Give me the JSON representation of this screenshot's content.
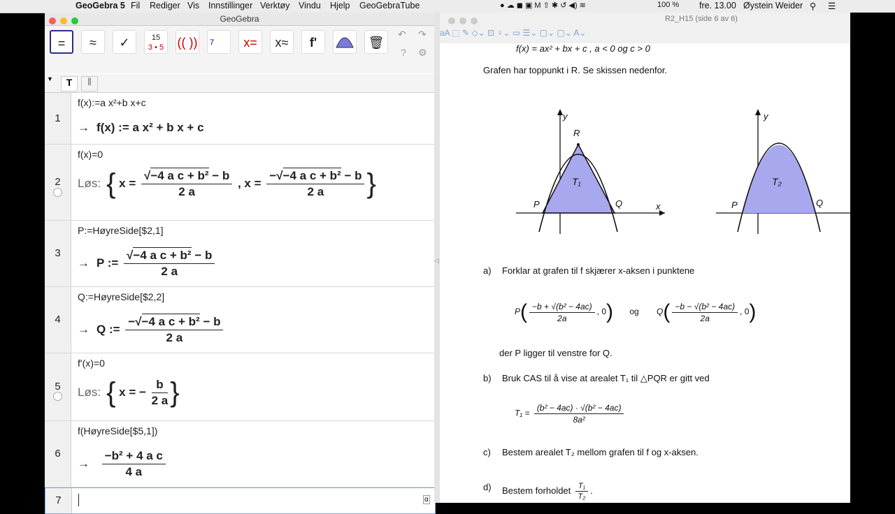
{
  "menubar": {
    "app_name": "GeoGebra 5",
    "items": [
      "Fil",
      "Rediger",
      "Vis",
      "Innstillinger",
      "Verktøy",
      "Vindu",
      "Hjelp",
      "GeoGebraTube"
    ],
    "battery": "100 %",
    "clock": "fre. 13.00",
    "user": "Øystein Weider"
  },
  "geogebra": {
    "window_title": "GeoGebra",
    "tools": [
      "=",
      "≈",
      "✓",
      "15/3·5",
      "(( ))",
      "7",
      "x=",
      "x≈",
      "f'",
      "bell",
      "trash"
    ],
    "style_t": "T"
  },
  "cas": [
    {
      "n": "1",
      "input": "f(x):=a x²+b x+c",
      "out_prefix": "→",
      "output": "f(x) := a x² + b x + c"
    },
    {
      "n": "2",
      "input": "f(x)=0",
      "out_prefix": "Løs:",
      "output": "x = (√(−4 a c + b²) − b) / (2 a) , x = (−√(−4 a c + b²) − b) / (2 a)"
    },
    {
      "n": "3",
      "input": "P:=HøyreSide[$2,1]",
      "out_prefix": "→",
      "output": "P := (√(−4 a c + b²) − b) / (2 a)"
    },
    {
      "n": "4",
      "input": "Q:=HøyreSide[$2,2]",
      "out_prefix": "→",
      "output": "Q := (−√(−4 a c + b²) − b) / (2 a)"
    },
    {
      "n": "5",
      "input": "f'(x)=0",
      "out_prefix": "Løs:",
      "output": "x = − b / (2 a)"
    },
    {
      "n": "6",
      "input": "f(HøyreSide[$5,1])",
      "out_prefix": "→",
      "output": "(−b² + 4 a c) / (4 a)"
    },
    {
      "n": "7",
      "input": "",
      "out_prefix": "",
      "output": ""
    }
  ],
  "cas_fracs": {
    "sqrt_expr": "−4 a c + b²",
    "minus_b": " − b",
    "two_a": "2 a",
    "neg": "−",
    "b": "b",
    "row6_num": "−b² + 4 a c",
    "row6_den": "4 a"
  },
  "document": {
    "title": "R2_H15 (side 6 av 6)",
    "line1": "f(x) = ax² + bx + c ,     a < 0   og   c > 0",
    "line2": "Grafen har toppunkt i  R. Se skissen nedenfor.",
    "labels": {
      "y1": "y",
      "R": "R",
      "T1": "T₁",
      "P": "P",
      "Q": "Q",
      "x": "x",
      "y2": "y",
      "T2": "T₂",
      "P2": "P",
      "Q2": "Q"
    },
    "a_label": "a)",
    "a_text": "Forklar at grafen til  f  skjærer x-aksen i punktene",
    "a_P": "P",
    "a_P_num": "−b + √(b² − 4ac)",
    "a_P_den": "2a",
    "a_og": "og",
    "a_Q": "Q",
    "a_Q_num": "−b − √(b² − 4ac)",
    "a_Q_den": "2a",
    "a_zero": ", 0",
    "a_note": "der  P  ligger til venstre for  Q.",
    "b_label": "b)",
    "b_text": "Bruk CAS til å vise at arealet  T₁  til  △PQR  er gitt ved",
    "b_T1": "T₁ =",
    "b_num": "(b² − 4ac) · √(b² − 4ac)",
    "b_den": "8a²",
    "c_label": "c)",
    "c_text": "Bestem arealet  T₂  mellom grafen til  f  og  x-aksen.",
    "d_label": "d)",
    "d_text": "Bestem forholdet",
    "d_num": "T₁",
    "d_den": "T₂"
  },
  "colors": {
    "fill": "#a8a8ee",
    "accent": "#2d2d8a"
  }
}
